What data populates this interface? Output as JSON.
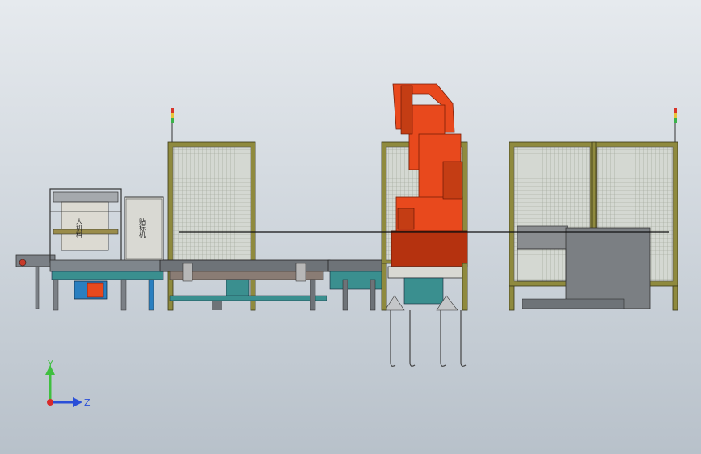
{
  "labels": {
    "station_left": "人机料",
    "station_right": "贴标机"
  },
  "triad": {
    "y_label": "Y",
    "z_label": "Z",
    "y_color": "#3fbf3f",
    "z_color": "#2a4fd8",
    "x_color": "#d82a2a"
  },
  "colors": {
    "robot": "#e8491d",
    "robot_shadow": "#b5320f",
    "frame": "#8f8a3e",
    "conveyor": "#6e7378",
    "accent_teal": "#3a8f8f",
    "accent_blue": "#2a7fc0",
    "beacon_red": "#d8352a",
    "beacon_green": "#3bb34a"
  }
}
